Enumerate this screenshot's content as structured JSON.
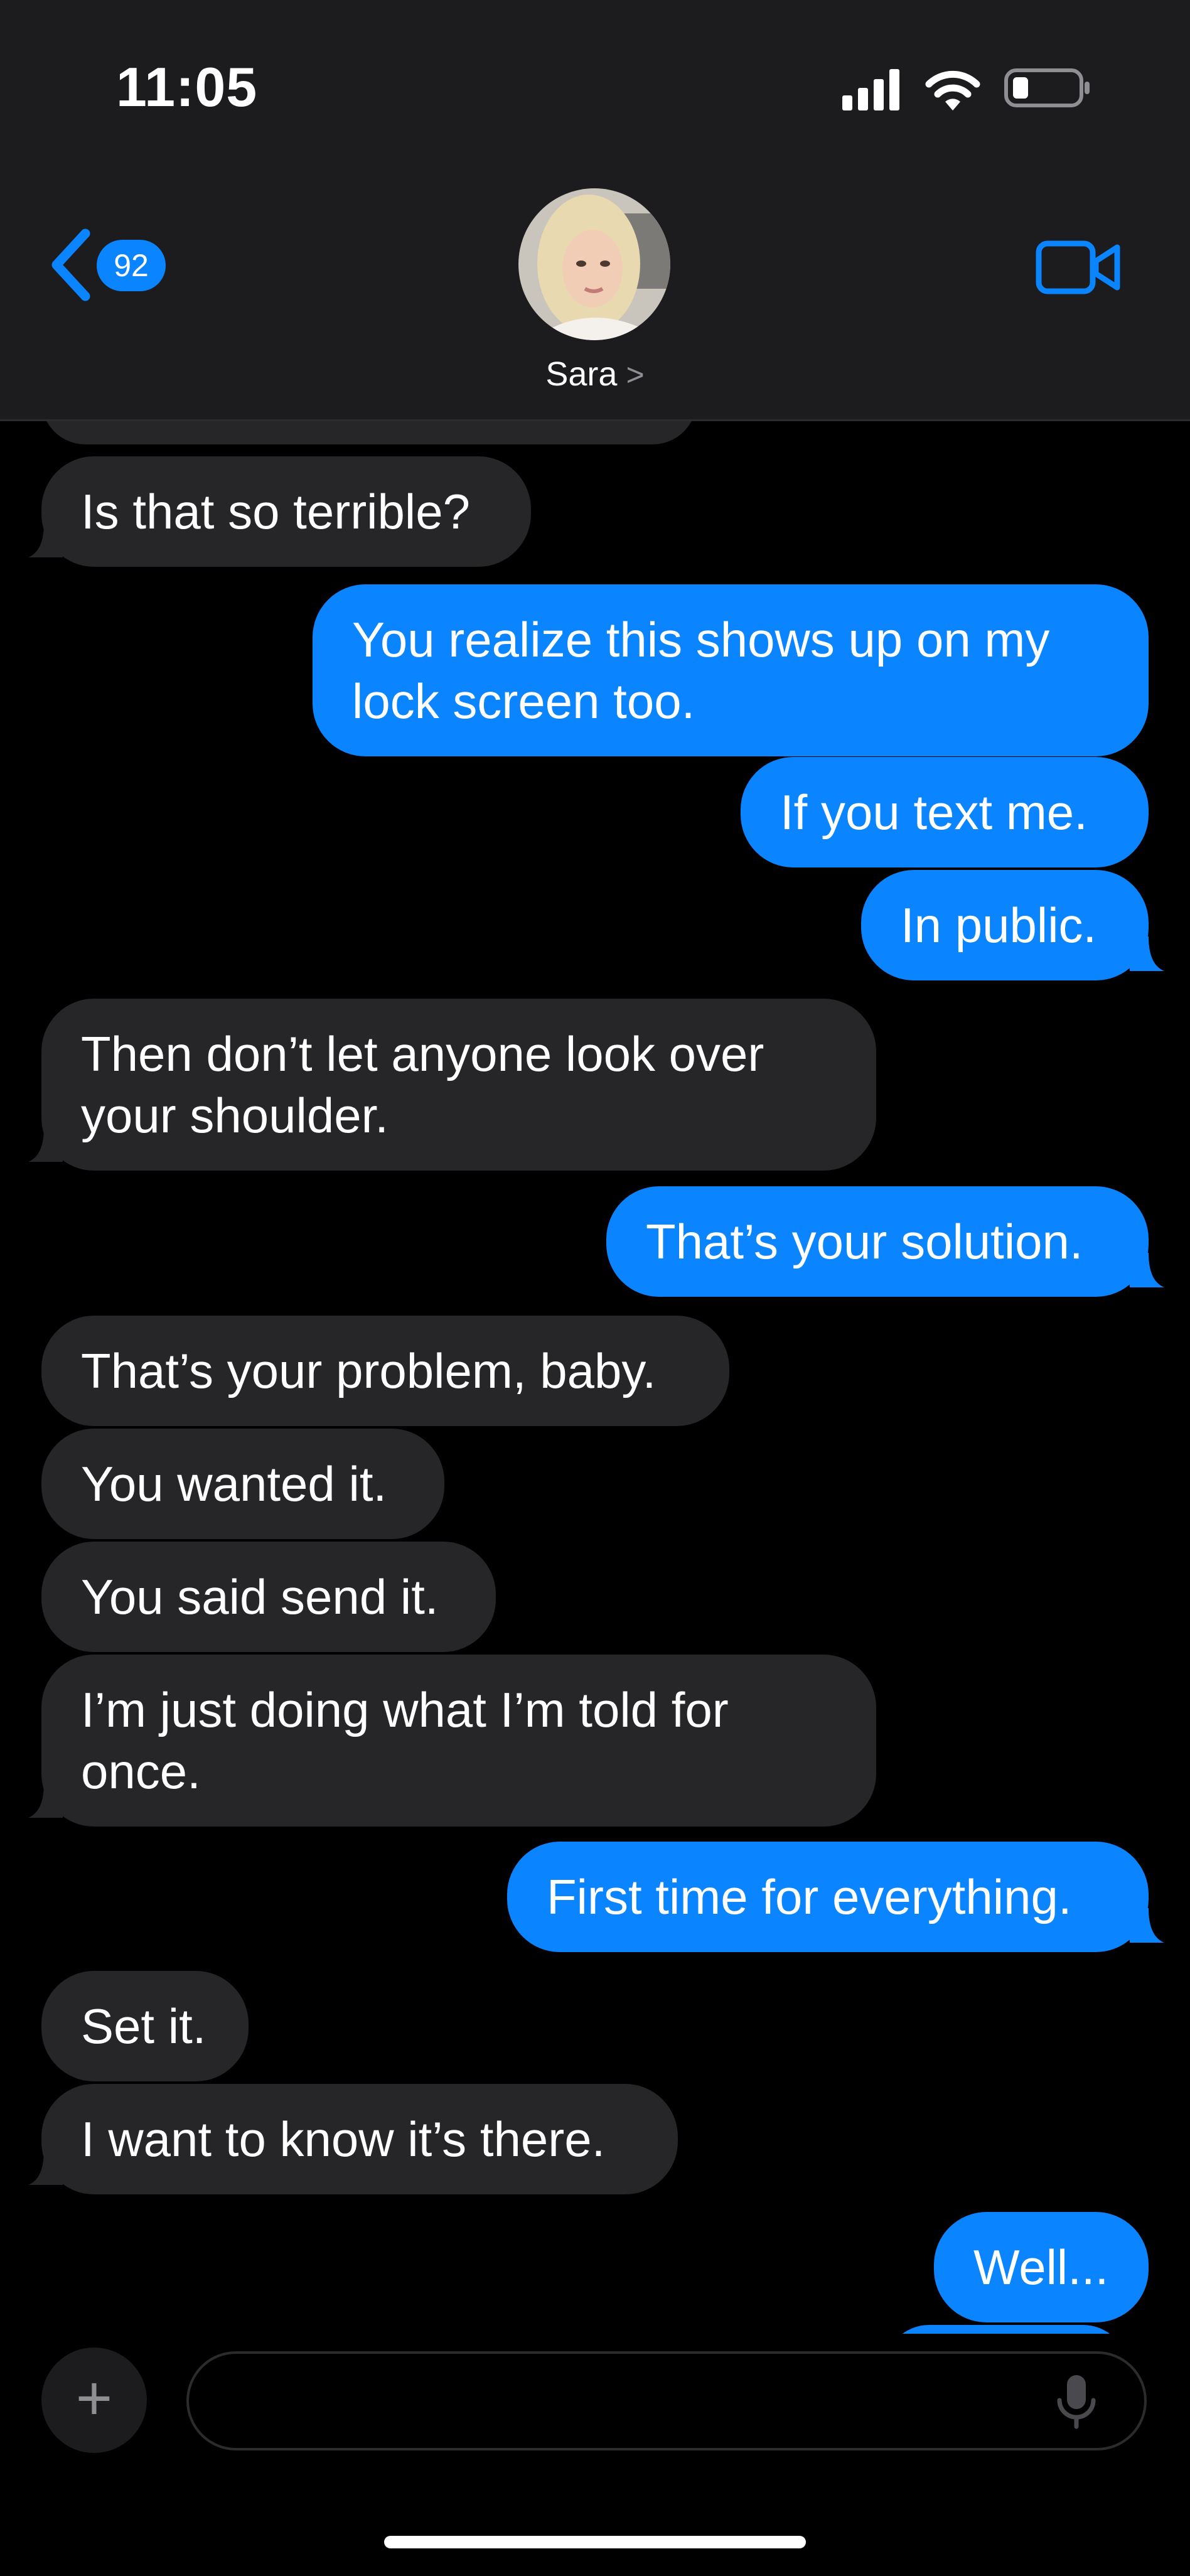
{
  "status_bar": {
    "time": "11:05"
  },
  "nav": {
    "back_badge": "92",
    "contact_name": "Sara",
    "contact_chevron": ">"
  },
  "messages": [
    {
      "from": "contact",
      "text": "Is that so terrible?"
    },
    {
      "from": "me",
      "text": "You realize this shows up on my lock screen too."
    },
    {
      "from": "me",
      "text": "If you text me."
    },
    {
      "from": "me",
      "text": "In public."
    },
    {
      "from": "contact",
      "text": "Then don’t let anyone look over your shoulder."
    },
    {
      "from": "me",
      "text": "That’s your solution."
    },
    {
      "from": "contact",
      "text": "That’s your problem, baby."
    },
    {
      "from": "contact",
      "text": "You wanted it."
    },
    {
      "from": "contact",
      "text": "You said send it."
    },
    {
      "from": "contact",
      "text": "I’m just doing what I’m told for once."
    },
    {
      "from": "me",
      "text": "First time for everything."
    },
    {
      "from": "contact",
      "text": "Set it."
    },
    {
      "from": "contact",
      "text": "I want to know it’s there."
    },
    {
      "from": "me",
      "text": "Well..."
    }
  ],
  "colors": {
    "sent_bubble": "#0a84ff",
    "received_bubble": "#262628",
    "accent": "#0a84ff"
  },
  "icons": {
    "back": "chevron-left-icon",
    "video": "video-camera-icon",
    "plus": "plus-icon",
    "mic": "microphone-icon"
  }
}
